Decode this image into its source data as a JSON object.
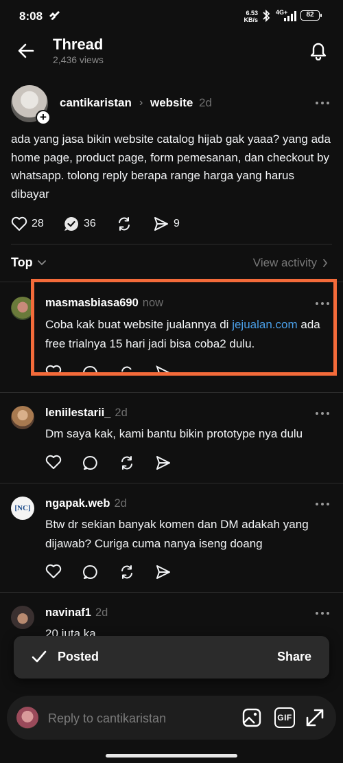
{
  "status_bar": {
    "time": "8:08",
    "net_speed_value": "6.53",
    "net_speed_unit": "KB/s",
    "network": "4G+",
    "battery": "82"
  },
  "header": {
    "title": "Thread",
    "views": "2,436 views"
  },
  "post": {
    "author": "cantikaristan",
    "topic": "website",
    "time": "2d",
    "text": "ada yang jasa bikin website catalog hijab gak yaaa? yang ada home page, product page, form pemesanan, dan checkout by whatsapp. tolong reply berapa range harga yang harus dibayar",
    "likes": "28",
    "replies": "36",
    "shares": "9"
  },
  "replies_header": {
    "sort": "Top",
    "view_activity": "View activity"
  },
  "replies": [
    {
      "author": "masmasbiasa690",
      "time": "now",
      "text_before": "Coba kak buat website jualannya di ",
      "link": "jejualan.com",
      "text_after": " ada free trialnya 15 hari jadi bisa coba2 dulu."
    },
    {
      "author": "leniilestarii_",
      "time": "2d",
      "text": "Dm saya kak, kami bantu bikin prototype nya dulu"
    },
    {
      "author": "ngapak.web",
      "time": "2d",
      "avatar_text": "[NC]",
      "text": "Btw dr sekian banyak komen dan DM adakah yang dijawab? Curiga cuma nanya iseng doang"
    },
    {
      "author": "navinaf1",
      "time": "2d",
      "text": "20 juta ka"
    }
  ],
  "toast": {
    "label": "Posted",
    "action": "Share"
  },
  "composer": {
    "placeholder": "Reply to cantikaristan",
    "gif_label": "GIF"
  },
  "colors": {
    "background": "#101010",
    "link": "#4a9fe8",
    "highlight": "#f46b3a"
  }
}
